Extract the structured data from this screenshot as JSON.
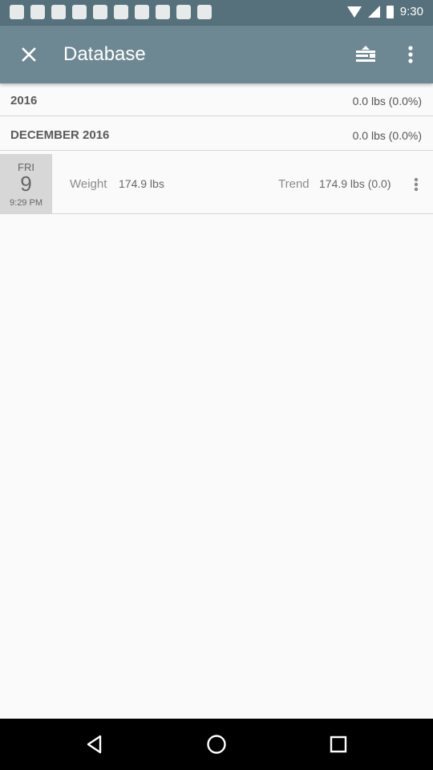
{
  "status_bar": {
    "time": "9:30",
    "left_icons": [
      "app-icon-1",
      "app-icon-2",
      "app-icon-3",
      "app-icon-4",
      "app-icon-5",
      "app-icon-6",
      "app-icon-7",
      "app-icon-8",
      "app-icon-9",
      "app-icon-10"
    ],
    "right_icons": [
      "wifi-icon",
      "signal-icon",
      "battery-icon"
    ]
  },
  "appbar": {
    "title": "Database",
    "close_icon": "close-icon",
    "tool_icon": "import-export-icon",
    "more_icon": "more-vert-icon",
    "color": "#6e8893"
  },
  "groups": {
    "year": {
      "label": "2016",
      "value": "0.0 lbs (0.0%)"
    },
    "month": {
      "label": "DECEMBER 2016",
      "value": "0.0 lbs (0.0%)"
    }
  },
  "entry": {
    "day": "FRI",
    "date": "9",
    "time": "9:29 PM",
    "weight_label": "Weight",
    "weight_value": "174.9 lbs",
    "trend_label": "Trend",
    "trend_value": "174.9 lbs (0.0)",
    "menu_icon": "more-vert-icon"
  },
  "nav_bar": {
    "icons": [
      "back-icon",
      "home-icon",
      "recent-apps-icon"
    ]
  }
}
